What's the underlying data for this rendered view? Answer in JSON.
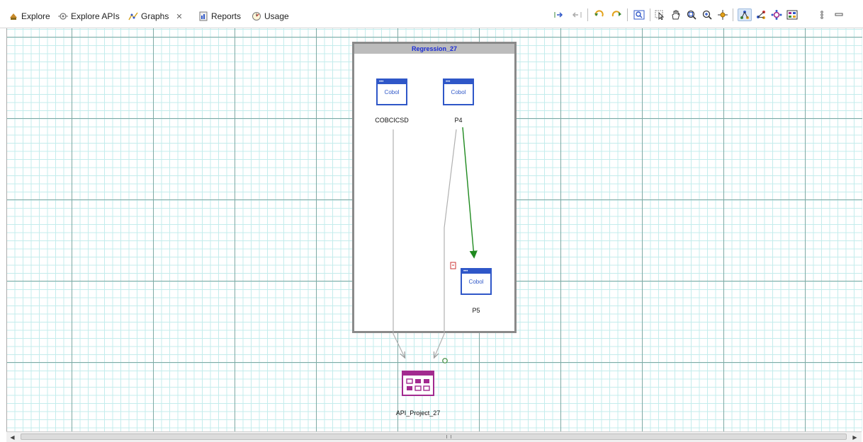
{
  "tabs": [
    {
      "label": "Explore",
      "icon": "explore-icon",
      "active": false
    },
    {
      "label": "Explore APIs",
      "icon": "explore-apis-icon",
      "active": false
    },
    {
      "label": "Graphs",
      "icon": "graphs-icon",
      "active": true,
      "close_glyph": "✕"
    },
    {
      "label": "Reports",
      "icon": "reports-icon",
      "active": false
    },
    {
      "label": "Usage",
      "icon": "usage-icon",
      "active": false
    }
  ],
  "toolbar_icons": [
    "expand-icon",
    "collapse-icon",
    "undo-icon",
    "redo-icon",
    "search-icon",
    "select-pointer-icon",
    "pan-hand-icon",
    "zoom-box-icon",
    "zoom-in-icon",
    "center-icon",
    "layout-tree-icon",
    "layout-radial-icon",
    "layout-symmetric-icon",
    "layout-grid-icon",
    "view-menu-icon",
    "minimize-icon"
  ],
  "graph": {
    "container_title": "Regression_27",
    "nodes": [
      {
        "id": "cobcicsd",
        "label": "COBCICSD",
        "box_text": "Cobol",
        "type": "cobol"
      },
      {
        "id": "p4",
        "label": "P4",
        "box_text": "Cobol",
        "type": "cobol"
      },
      {
        "id": "p5",
        "label": "P5",
        "box_text": "Cobol",
        "type": "cobol"
      },
      {
        "id": "api",
        "label": "API_Project_27",
        "type": "api-project"
      }
    ],
    "colors": {
      "cobol_blue": "#2f57c8",
      "api_purple": "#a22a8f",
      "edge_gray": "#b0b0b0",
      "edge_green": "#1f8a1f",
      "container_title": "#1a2bd6"
    }
  }
}
